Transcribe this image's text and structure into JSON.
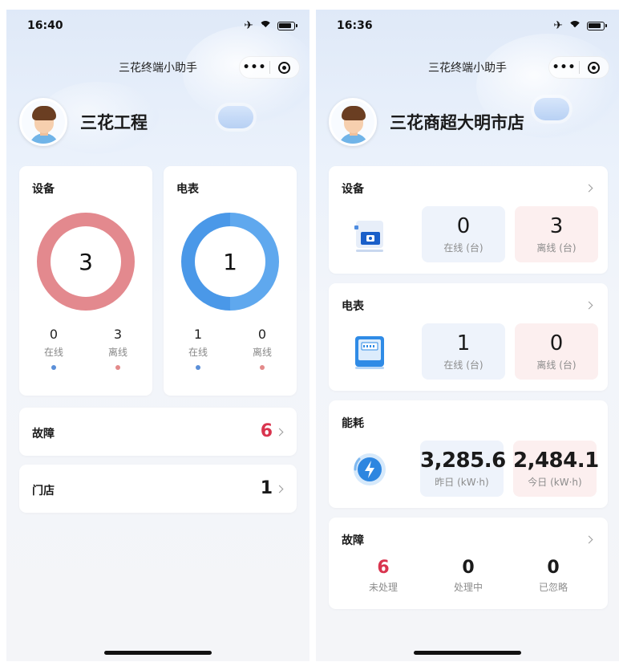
{
  "left": {
    "status": {
      "time": "16:40"
    },
    "nav": {
      "title": "三花终端小助手"
    },
    "profile": {
      "name": "三花工程"
    },
    "device_card": {
      "title": "设备",
      "total": "3",
      "online_value": "0",
      "online_label": "在线",
      "offline_value": "3",
      "offline_label": "离线",
      "ring_color": "#e3898e"
    },
    "meter_card": {
      "title": "电表",
      "total": "1",
      "online_value": "1",
      "online_label": "在线",
      "offline_value": "0",
      "offline_label": "离线",
      "ring_color": "#5fa8ee"
    },
    "fault_row": {
      "label": "故障",
      "value": "6"
    },
    "store_row": {
      "label": "门店",
      "value": "1"
    }
  },
  "right": {
    "status": {
      "time": "16:36"
    },
    "nav": {
      "title": "三花终端小助手"
    },
    "profile": {
      "name": "三花商超大明市店"
    },
    "device_card": {
      "title": "设备",
      "online_value": "0",
      "online_label": "在线 (台)",
      "offline_value": "3",
      "offline_label": "离线 (台)"
    },
    "meter_card": {
      "title": "电表",
      "online_value": "1",
      "online_label": "在线 (台)",
      "offline_value": "0",
      "offline_label": "离线 (台)"
    },
    "energy_card": {
      "title": "能耗",
      "yesterday_value": "3,285.6",
      "yesterday_label": "昨日 (kW·h)",
      "today_value": "2,484.1",
      "today_label": "今日 (kW·h)"
    },
    "fault_card": {
      "title": "故障",
      "unhandled_value": "6",
      "unhandled_label": "未处理",
      "processing_value": "0",
      "processing_label": "处理中",
      "ignored_value": "0",
      "ignored_label": "已忽略"
    }
  },
  "colors": {
    "online_dot": "#5b8fd8",
    "offline_dot": "#e38a8a",
    "fault_red": "#d9344e"
  },
  "icons": {
    "status": [
      "airplane-icon",
      "wifi-icon",
      "battery-icon"
    ],
    "capsule": [
      "more-icon",
      "target-icon"
    ]
  }
}
